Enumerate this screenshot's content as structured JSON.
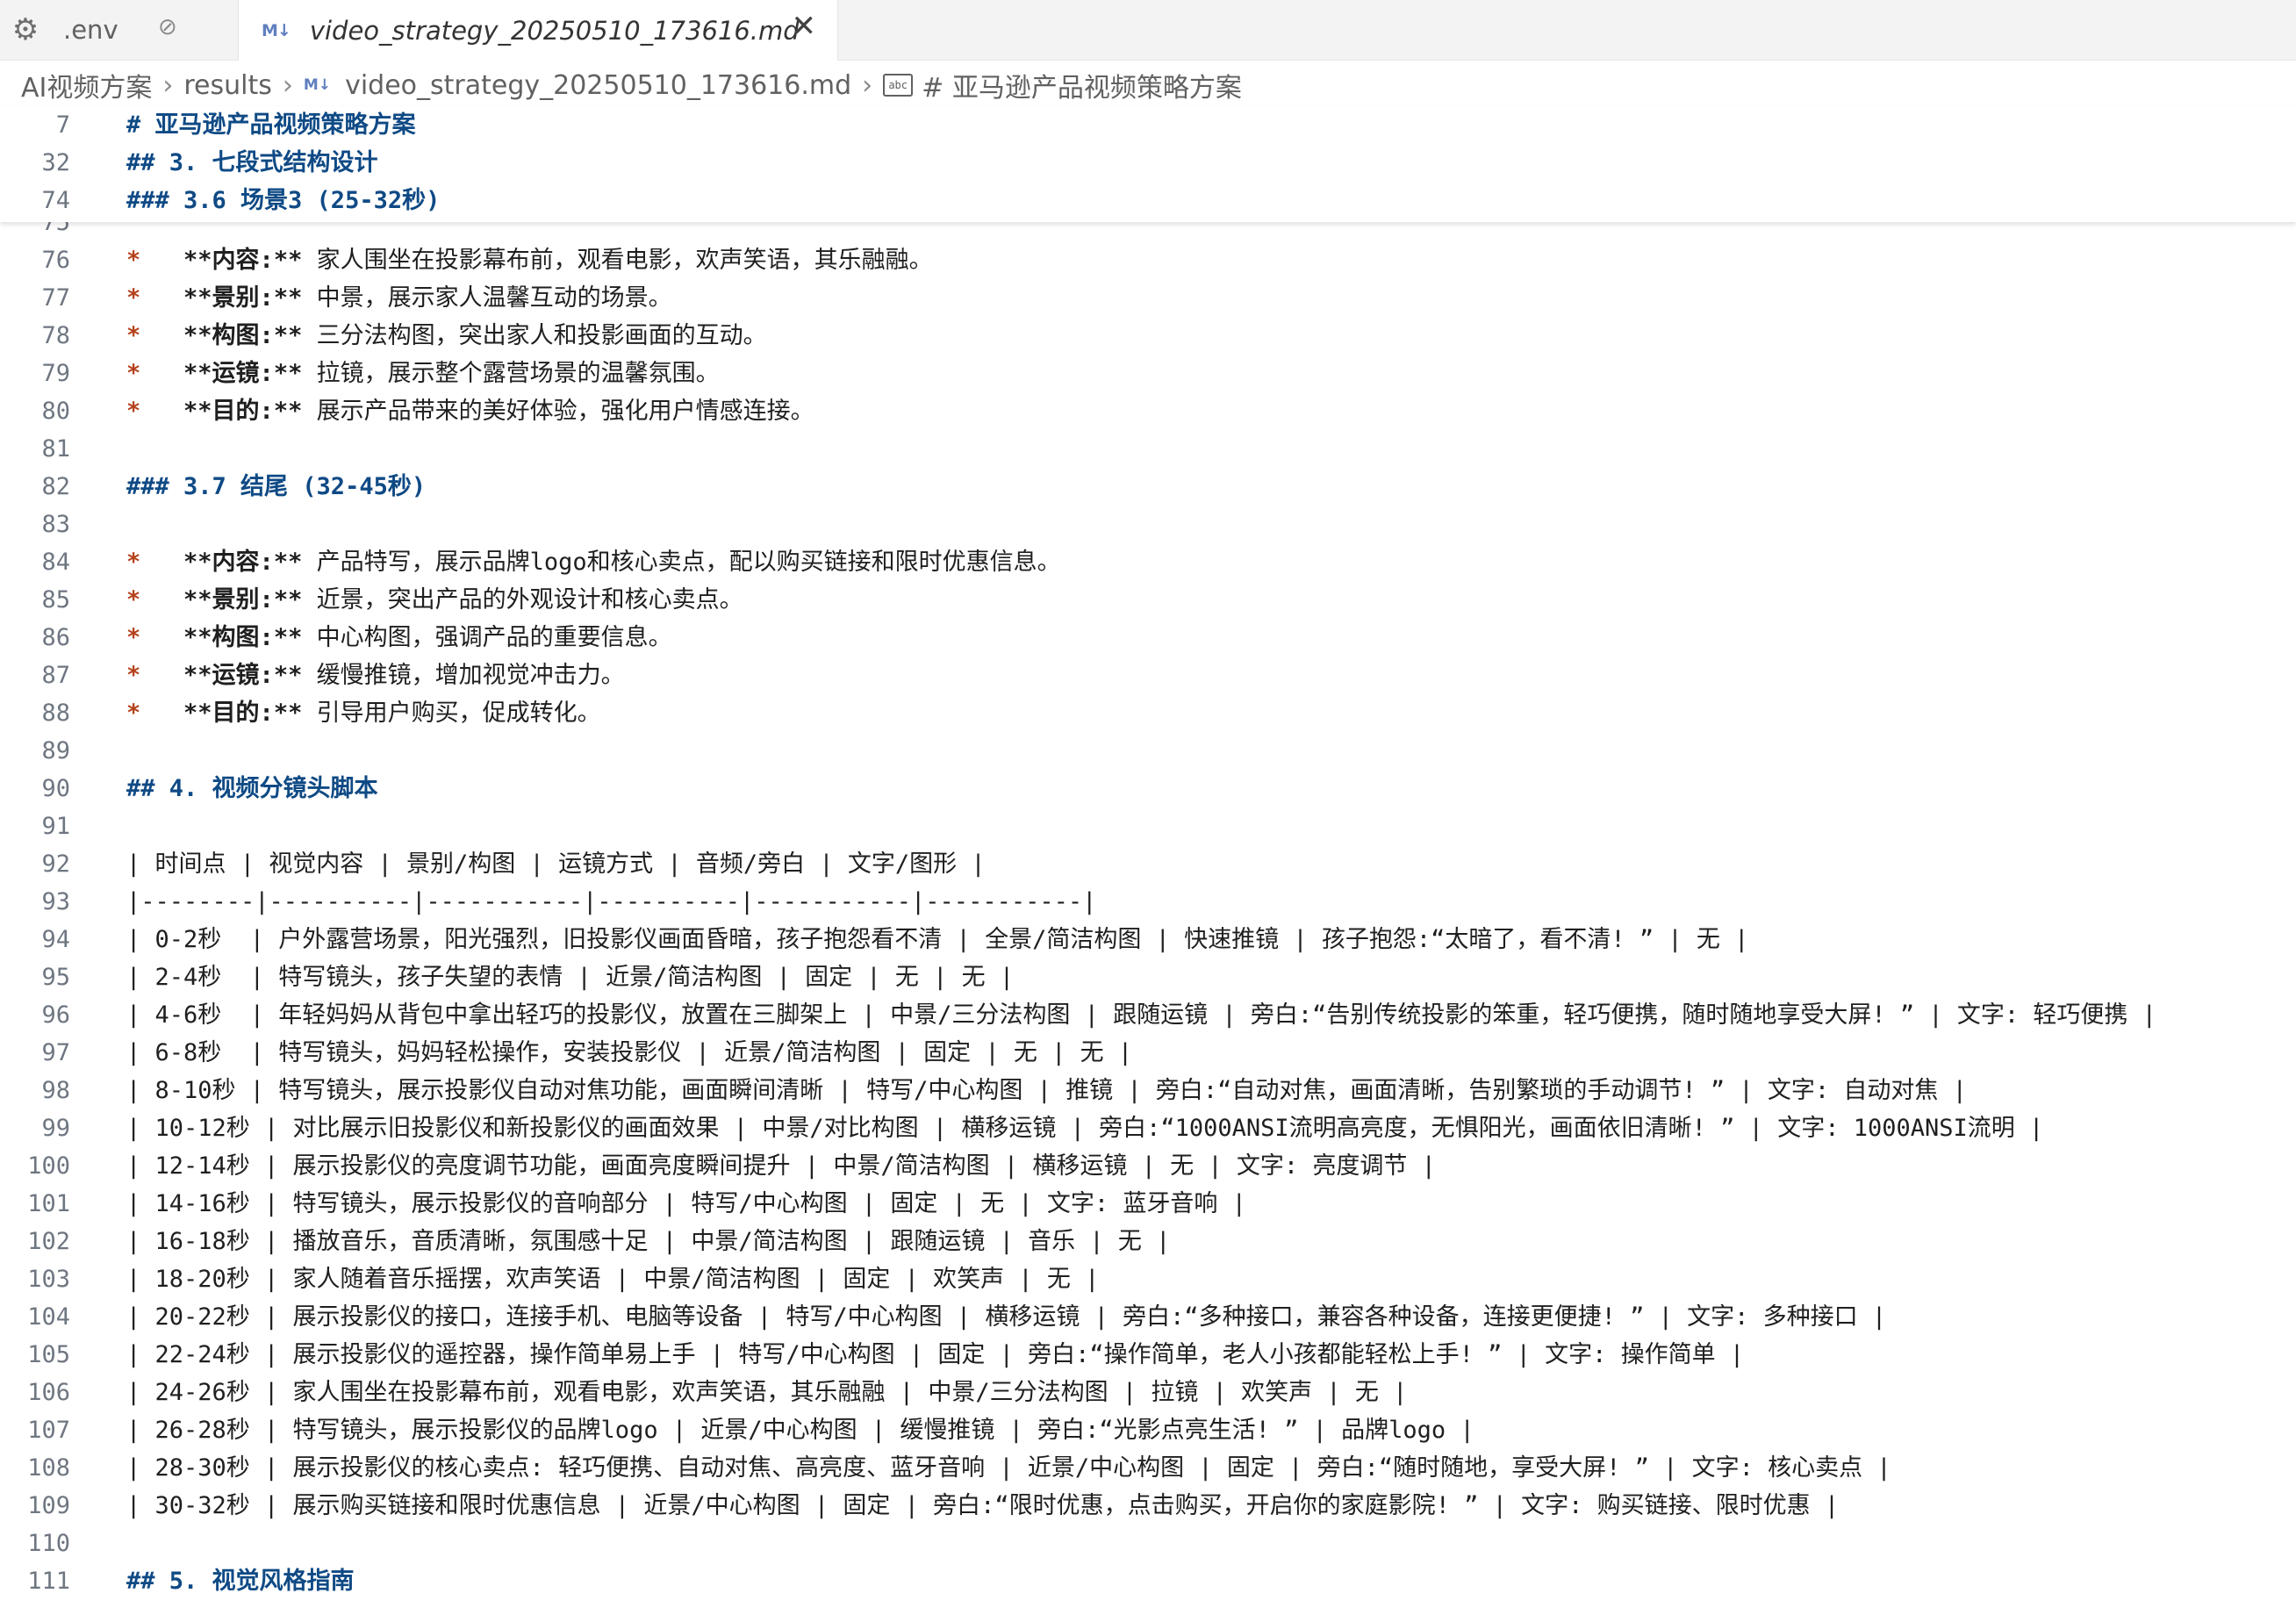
{
  "tabs": [
    {
      "label": ".env",
      "icon": "gear-icon",
      "pin_glyph": "⊘",
      "active": false
    },
    {
      "label": "video_strategy_20250510_173616.md",
      "icon": "markdown-icon",
      "icon_text": "M↓",
      "close_glyph": "✕",
      "active": true
    }
  ],
  "breadcrumb": {
    "items": [
      "AI视频方案",
      "results",
      "video_strategy_20250510_173616.md",
      "# 亚马逊产品视频策略方案"
    ],
    "md_icon_text": "M↓",
    "symbol_icon_text": "abc",
    "separator": "›"
  },
  "sticky_lines": [
    {
      "num": "7",
      "text": "# 亚马逊产品视频策略方案"
    },
    {
      "num": "32",
      "text": "## 3. 七段式结构设计"
    },
    {
      "num": "74",
      "text": "### 3.6 场景3 (25-32秒)"
    }
  ],
  "lines": [
    {
      "num": "75",
      "kind": "blank",
      "text": ""
    },
    {
      "num": "76",
      "kind": "bullet",
      "bullet": "*",
      "label": "**内容:**",
      "text": " 家人围坐在投影幕布前，观看电影，欢声笑语，其乐融融。"
    },
    {
      "num": "77",
      "kind": "bullet",
      "bullet": "*",
      "label": "**景别:**",
      "text": " 中景，展示家人温馨互动的场景。"
    },
    {
      "num": "78",
      "kind": "bullet",
      "bullet": "*",
      "label": "**构图:**",
      "text": " 三分法构图，突出家人和投影画面的互动。"
    },
    {
      "num": "79",
      "kind": "bullet",
      "bullet": "*",
      "label": "**运镜:**",
      "text": " 拉镜，展示整个露营场景的温馨氛围。"
    },
    {
      "num": "80",
      "kind": "bullet",
      "bullet": "*",
      "label": "**目的:**",
      "text": " 展示产品带来的美好体验，强化用户情感连接。"
    },
    {
      "num": "81",
      "kind": "blank",
      "text": ""
    },
    {
      "num": "82",
      "kind": "heading",
      "text": "### 3.7 结尾 (32-45秒)"
    },
    {
      "num": "83",
      "kind": "blank",
      "text": ""
    },
    {
      "num": "84",
      "kind": "bullet",
      "bullet": "*",
      "label": "**内容:**",
      "text": " 产品特写，展示品牌logo和核心卖点，配以购买链接和限时优惠信息。"
    },
    {
      "num": "85",
      "kind": "bullet",
      "bullet": "*",
      "label": "**景别:**",
      "text": " 近景，突出产品的外观设计和核心卖点。"
    },
    {
      "num": "86",
      "kind": "bullet",
      "bullet": "*",
      "label": "**构图:**",
      "text": " 中心构图，强调产品的重要信息。"
    },
    {
      "num": "87",
      "kind": "bullet",
      "bullet": "*",
      "label": "**运镜:**",
      "text": " 缓慢推镜，增加视觉冲击力。"
    },
    {
      "num": "88",
      "kind": "bullet",
      "bullet": "*",
      "label": "**目的:**",
      "text": " 引导用户购买，促成转化。"
    },
    {
      "num": "89",
      "kind": "blank",
      "text": ""
    },
    {
      "num": "90",
      "kind": "heading",
      "text": "## 4. 视频分镜头脚本"
    },
    {
      "num": "91",
      "kind": "blank",
      "text": ""
    },
    {
      "num": "92",
      "kind": "plain",
      "text": "| 时间点 | 视觉内容 | 景别/构图 | 运镜方式 | 音频/旁白 | 文字/图形 |"
    },
    {
      "num": "93",
      "kind": "plain",
      "text": "|--------|----------|-----------|----------|-----------|-----------|"
    },
    {
      "num": "94",
      "kind": "plain",
      "text": "| 0-2秒  | 户外露营场景，阳光强烈，旧投影仪画面昏暗，孩子抱怨看不清 | 全景/简洁构图 | 快速推镜 | 孩子抱怨:“太暗了，看不清! ” | 无 |"
    },
    {
      "num": "95",
      "kind": "plain",
      "text": "| 2-4秒  | 特写镜头，孩子失望的表情 | 近景/简洁构图 | 固定 | 无 | 无 |"
    },
    {
      "num": "96",
      "kind": "plain",
      "text": "| 4-6秒  | 年轻妈妈从背包中拿出轻巧的投影仪，放置在三脚架上 | 中景/三分法构图 | 跟随运镜 | 旁白:“告别传统投影的笨重，轻巧便携，随时随地享受大屏! ” | 文字: 轻巧便携 |"
    },
    {
      "num": "97",
      "kind": "plain",
      "text": "| 6-8秒  | 特写镜头，妈妈轻松操作，安装投影仪 | 近景/简洁构图 | 固定 | 无 | 无 |"
    },
    {
      "num": "98",
      "kind": "plain",
      "text": "| 8-10秒 | 特写镜头，展示投影仪自动对焦功能，画面瞬间清晰 | 特写/中心构图 | 推镜 | 旁白:“自动对焦，画面清晰，告别繁琐的手动调节! ” | 文字: 自动对焦 |"
    },
    {
      "num": "99",
      "kind": "plain",
      "text": "| 10-12秒 | 对比展示旧投影仪和新投影仪的画面效果 | 中景/对比构图 | 横移运镜 | 旁白:“1000ANSI流明高亮度，无惧阳光，画面依旧清晰! ” | 文字: 1000ANSI流明 |"
    },
    {
      "num": "100",
      "kind": "plain",
      "text": "| 12-14秒 | 展示投影仪的亮度调节功能，画面亮度瞬间提升 | 中景/简洁构图 | 横移运镜 | 无 | 文字: 亮度调节 |"
    },
    {
      "num": "101",
      "kind": "plain",
      "text": "| 14-16秒 | 特写镜头，展示投影仪的音响部分 | 特写/中心构图 | 固定 | 无 | 文字: 蓝牙音响 |"
    },
    {
      "num": "102",
      "kind": "plain",
      "text": "| 16-18秒 | 播放音乐，音质清晰，氛围感十足 | 中景/简洁构图 | 跟随运镜 | 音乐 | 无 |"
    },
    {
      "num": "103",
      "kind": "plain",
      "text": "| 18-20秒 | 家人随着音乐摇摆，欢声笑语 | 中景/简洁构图 | 固定 | 欢笑声 | 无 |"
    },
    {
      "num": "104",
      "kind": "plain",
      "text": "| 20-22秒 | 展示投影仪的接口，连接手机、电脑等设备 | 特写/中心构图 | 横移运镜 | 旁白:“多种接口，兼容各种设备，连接更便捷! ” | 文字: 多种接口 |"
    },
    {
      "num": "105",
      "kind": "plain",
      "text": "| 22-24秒 | 展示投影仪的遥控器，操作简单易上手 | 特写/中心构图 | 固定 | 旁白:“操作简单，老人小孩都能轻松上手! ” | 文字: 操作简单 |"
    },
    {
      "num": "106",
      "kind": "plain",
      "text": "| 24-26秒 | 家人围坐在投影幕布前，观看电影，欢声笑语，其乐融融 | 中景/三分法构图 | 拉镜 | 欢笑声 | 无 |"
    },
    {
      "num": "107",
      "kind": "plain",
      "text": "| 26-28秒 | 特写镜头，展示投影仪的品牌logo | 近景/中心构图 | 缓慢推镜 | 旁白:“光影点亮生活! ” | 品牌logo |"
    },
    {
      "num": "108",
      "kind": "plain",
      "text": "| 28-30秒 | 展示投影仪的核心卖点: 轻巧便携、自动对焦、高亮度、蓝牙音响 | 近景/中心构图 | 固定 | 旁白:“随时随地，享受大屏! ” | 文字: 核心卖点 |"
    },
    {
      "num": "109",
      "kind": "plain",
      "text": "| 30-32秒 | 展示购买链接和限时优惠信息 | 近景/中心构图 | 固定 | 旁白:“限时优惠，点击购买，开启你的家庭影院! ” | 文字: 购买链接、限时优惠 |"
    },
    {
      "num": "110",
      "kind": "blank",
      "text": ""
    },
    {
      "num": "111",
      "kind": "heading",
      "text": "## 5. 视觉风格指南"
    }
  ],
  "colors": {
    "heading": "#0f4a85",
    "bullet": "#b5421b",
    "line_number": "#6e7681",
    "tab_bar_bg": "#f3f3f3"
  }
}
